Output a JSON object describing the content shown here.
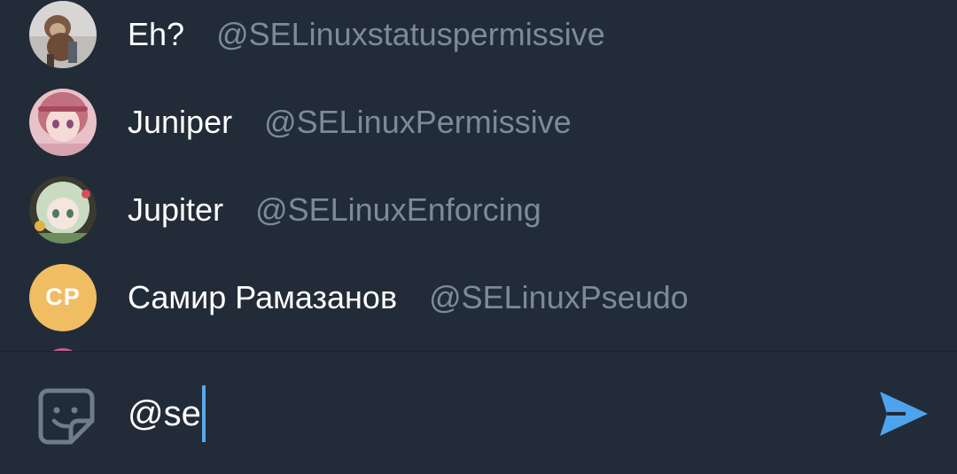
{
  "mentions": [
    {
      "name": "Eh?",
      "username": "@SELinuxstatuspermissive",
      "avatar": "photo-monkey"
    },
    {
      "name": "Juniper",
      "username": "@SELinuxPermissive",
      "avatar": "photo-anime-pink"
    },
    {
      "name": "Jupiter",
      "username": "@SELinuxEnforcing",
      "avatar": "photo-anime-green"
    },
    {
      "name": "Самир Рамазанов",
      "username": "@SELinuxPseudo",
      "avatar_initials": "CP",
      "avatar_color": "#f0bd63"
    }
  ],
  "input": {
    "value": "@se"
  },
  "icons": {
    "sticker": "sticker-icon",
    "send": "send-icon"
  },
  "colors": {
    "background": "#222b38",
    "username": "#7d8a99",
    "accent": "#5aa7e9",
    "send": "#4ea4ec"
  }
}
